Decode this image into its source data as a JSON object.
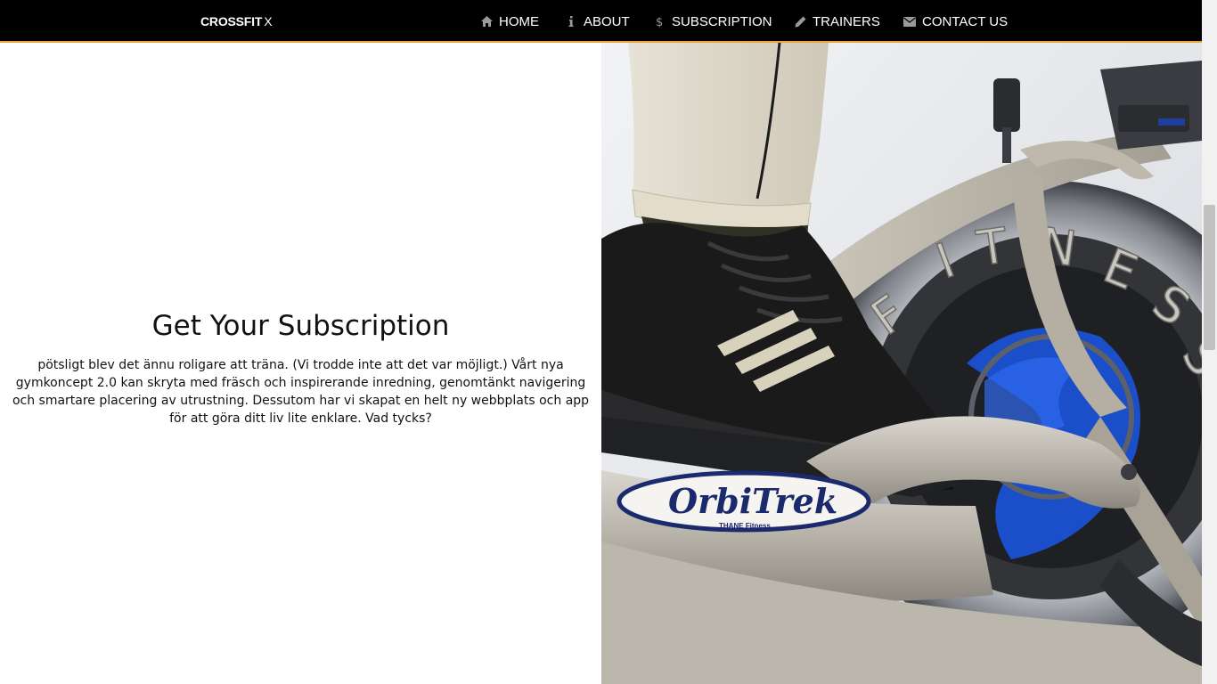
{
  "navbar": {
    "brand_bold": "CROSSFIT",
    "brand_suffix": "X",
    "items": [
      {
        "label": "HOME",
        "icon": "home-icon"
      },
      {
        "label": "ABOUT",
        "icon": "info-icon"
      },
      {
        "label": "SUBSCRIPTION",
        "icon": "dollar-icon"
      },
      {
        "label": "TRAINERS",
        "icon": "pencil-icon"
      },
      {
        "label": "CONTACT US",
        "icon": "envelope-icon"
      }
    ],
    "accent_color": "#f0a33a"
  },
  "main": {
    "title": "Get Your Subscription",
    "paragraph": "pötsligt blev det ännu roligare att träna. (Vi trodde inte att det var möjligt.) Vårt nya gymkoncept 2.0 kan skryta med fräsch och inspirerande inredning, genomtänkt navigering och smartare placering av utrustning. Dessutom har vi skapat en helt ny webbplats och app för att göra ditt liv lite enklare. Vad tycks?"
  },
  "hero": {
    "brand_text": "OrbiTrek",
    "brand_sub": "THANE Fitness",
    "wheel_text": "FITNESS ORBITREK"
  }
}
